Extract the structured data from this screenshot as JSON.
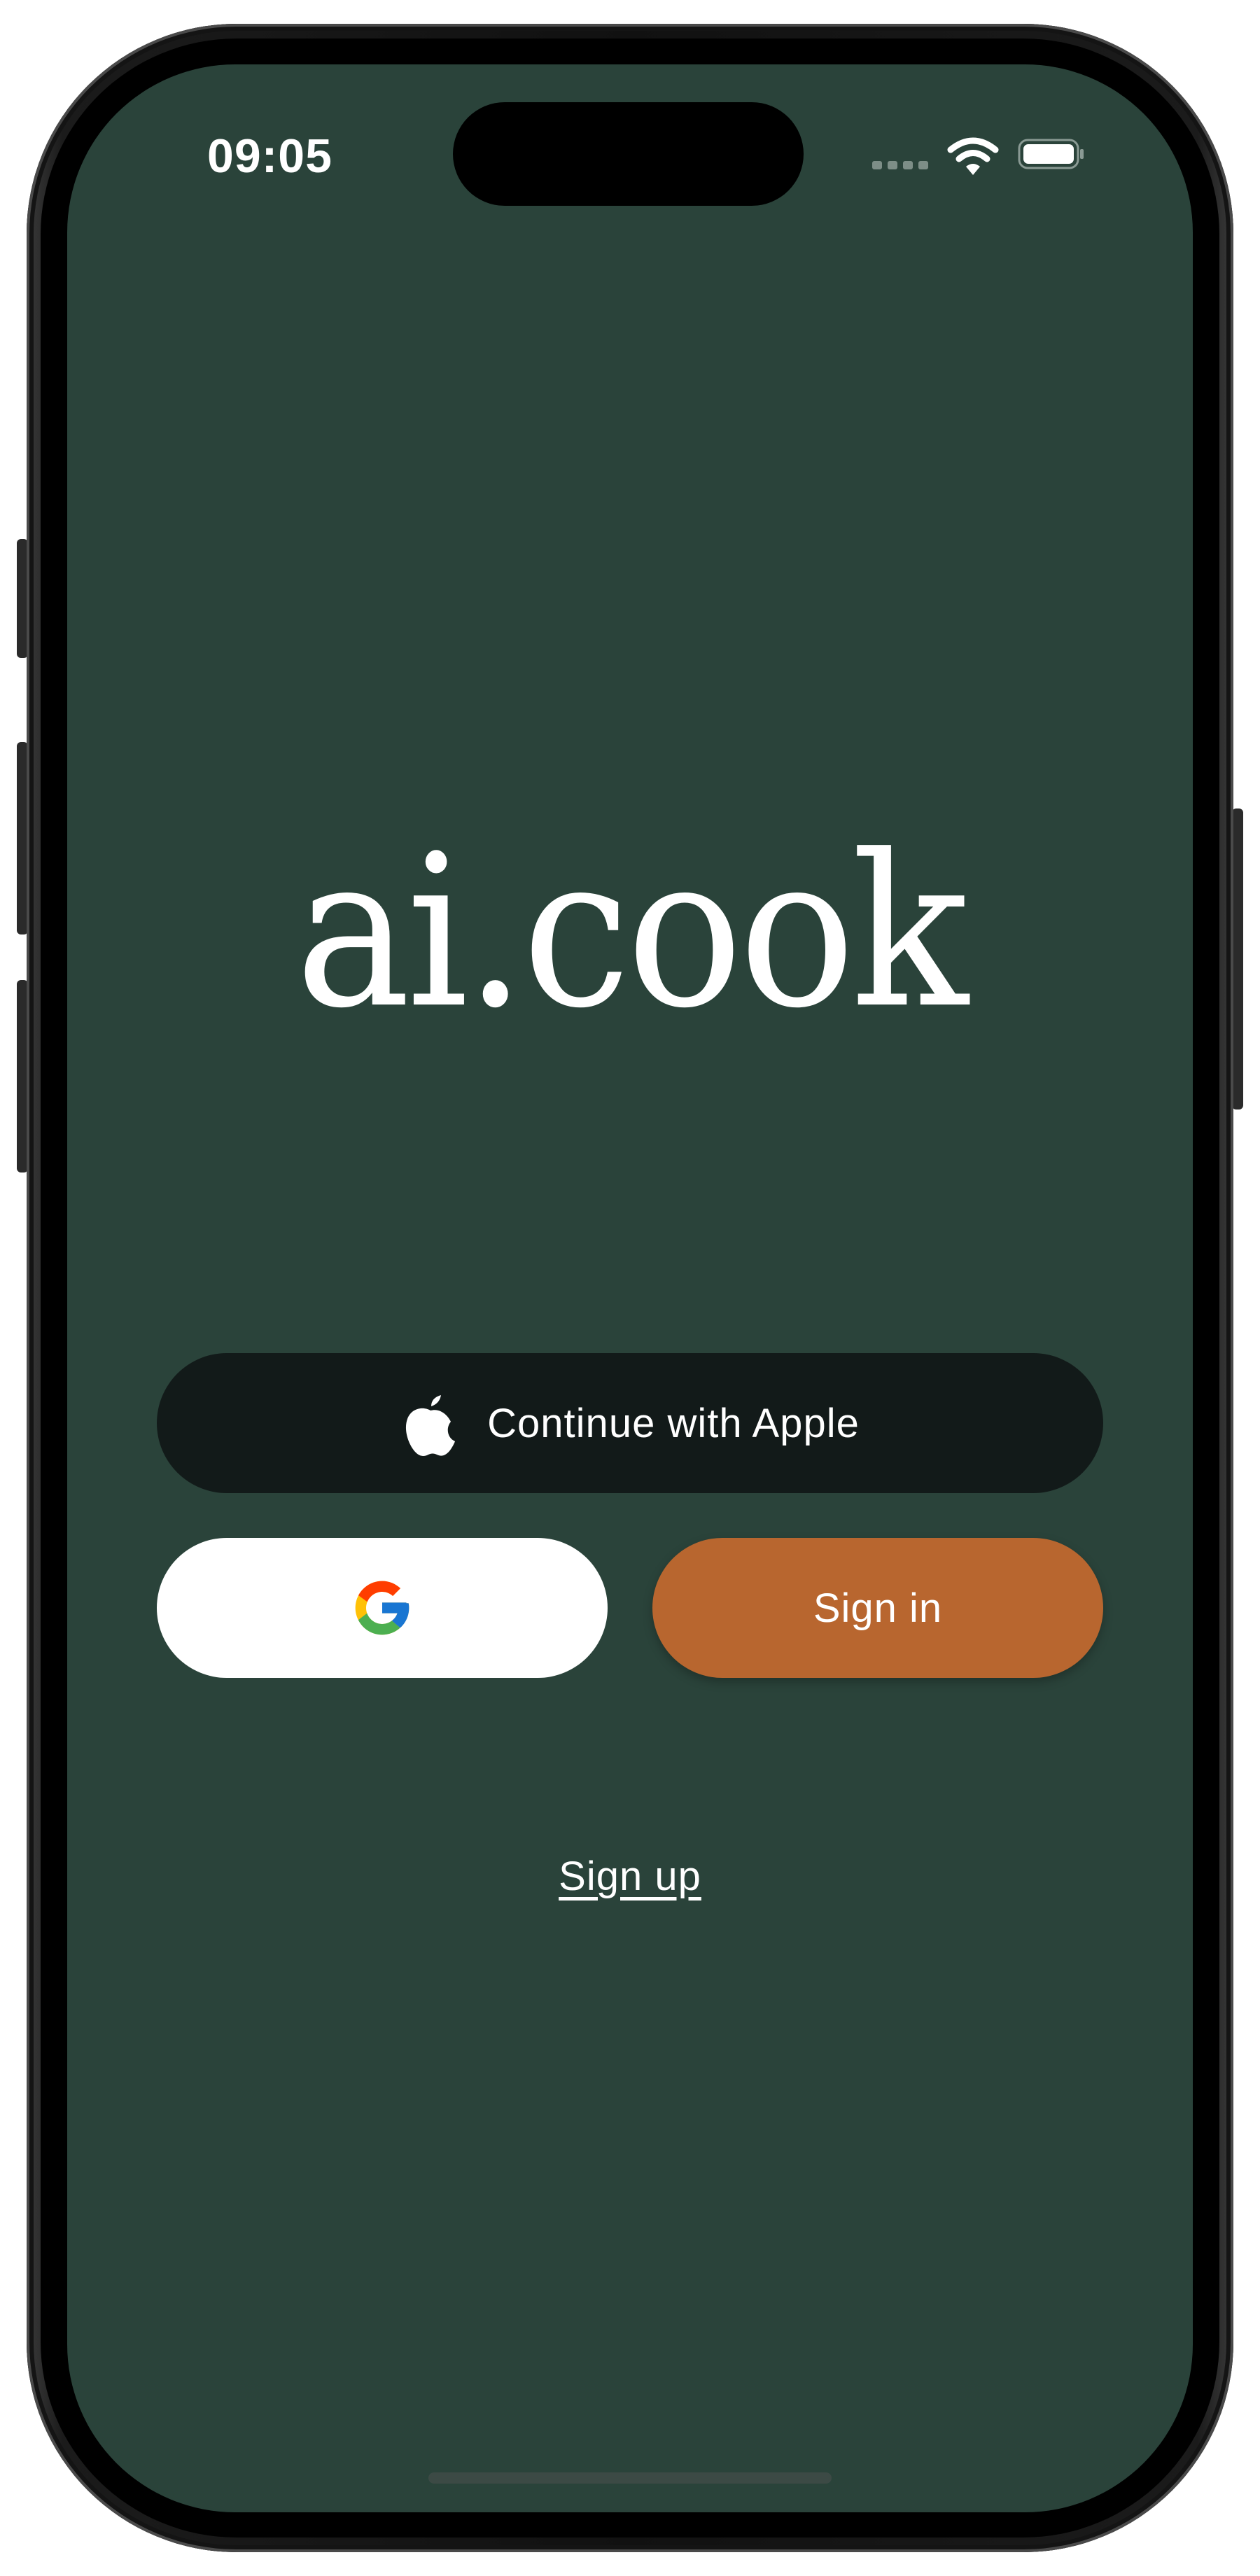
{
  "status_bar": {
    "time": "09:05",
    "signal_icon": "cellular-signal-icon",
    "wifi_icon": "wifi-icon",
    "battery_icon": "battery-icon"
  },
  "app": {
    "logo_text": "ai.cook",
    "background_color": "#2a433a"
  },
  "auth": {
    "apple_button_label": "Continue with Apple",
    "apple_icon": "apple-logo-icon",
    "google_icon": "google-logo-icon",
    "signin_button_label": "Sign in",
    "signup_link_label": "Sign up",
    "colors": {
      "apple_button": "#121a19",
      "google_button": "#ffffff",
      "signin_button": "#b8662f"
    }
  }
}
